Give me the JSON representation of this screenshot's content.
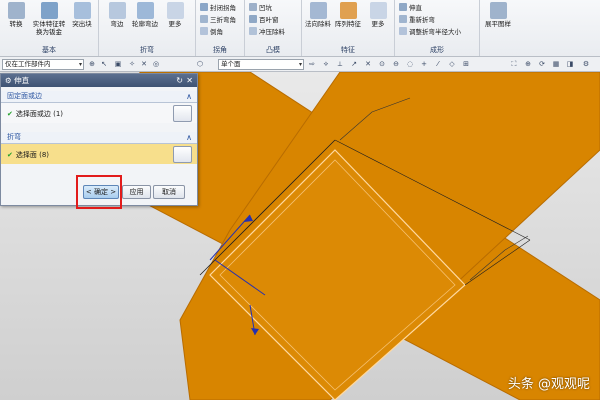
{
  "ribbon": {
    "groups": [
      {
        "label": "基本",
        "buttons": [
          "转换",
          "实体特征转换为钣金",
          "突出块"
        ]
      },
      {
        "label": "折弯",
        "buttons": [
          "弯边",
          "轮廓弯边",
          "更多"
        ]
      },
      {
        "label": "拐角",
        "items": [
          "封闭拐角",
          "三折弯角",
          "倒角"
        ]
      },
      {
        "label": "凸模",
        "items": [
          "凹坑",
          "百叶窗",
          "冲压除料"
        ]
      },
      {
        "label": "特征",
        "buttons": [
          "法向除料",
          "阵列特征",
          "更多"
        ]
      },
      {
        "label": "成形",
        "items": [
          "伸直",
          "重新折弯",
          "调整折弯半径大小"
        ]
      },
      {
        "label": "",
        "buttons": [
          "展平图样"
        ]
      }
    ]
  },
  "toolbar": {
    "filter_value": "仅在工作部件内",
    "select_value": "单个面"
  },
  "dialog": {
    "title": "伸直",
    "sections": [
      {
        "header": "固定面或边",
        "row": "选择面或边 (1)"
      },
      {
        "header": "折弯",
        "row": "选择面 (8)"
      }
    ],
    "ok_label": "< 确定 >",
    "apply_label": "应用",
    "cancel_label": "取消"
  },
  "watermark": "头条 @观观呢",
  "colors": {
    "part": "#d88500",
    "edge": "#ffd9a0",
    "highlight": "#e21b1b",
    "accent": "#2a54a0"
  }
}
